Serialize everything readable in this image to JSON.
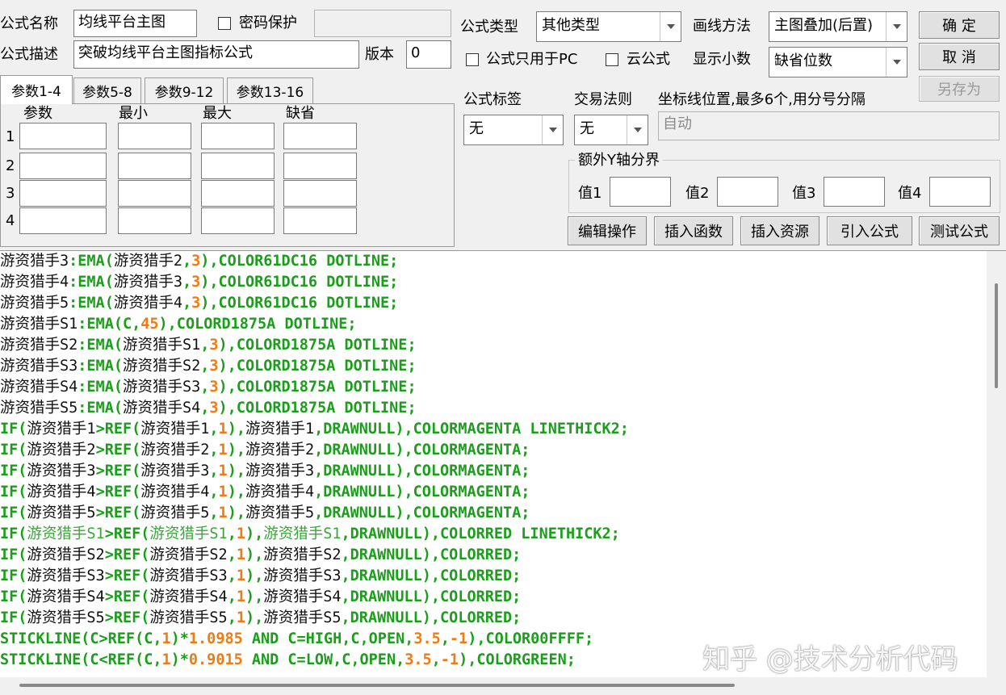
{
  "form": {
    "name_label": "公式名称",
    "name_value": "均线平台主图",
    "password_label": "密码保护",
    "type_label": "公式类型",
    "type_value": "其他类型",
    "draw_label": "画线方法",
    "draw_value": "主图叠加(后置)",
    "desc_label": "公式描述",
    "desc_value": "突破均线平台主图指标公式",
    "version_label": "版本",
    "version_value": "0",
    "pc_only_label": "公式只用于PC",
    "cloud_label": "云公式",
    "decimals_label": "显示小数",
    "decimals_value": "缺省位数"
  },
  "buttons": {
    "ok": "确  定",
    "cancel": "取  消",
    "save_as": "另存为",
    "edit_ops": "编辑操作",
    "insert_func": "插入函数",
    "insert_res": "插入资源",
    "import_formula": "引入公式",
    "test_formula": "测试公式"
  },
  "tabs": [
    "参数1-4",
    "参数5-8",
    "参数9-12",
    "参数13-16"
  ],
  "params": {
    "headers": [
      "参数",
      "最小",
      "最大",
      "缺省"
    ],
    "rows": [
      "1",
      "2",
      "3",
      "4"
    ]
  },
  "right_panel": {
    "tag_label": "公式标签",
    "tag_value": "无",
    "rule_label": "交易法则",
    "rule_value": "无",
    "coord_label": "坐标线位置,最多6个,用分号分隔",
    "coord_placeholder": "自动",
    "yaxis_title": "额外Y轴分界",
    "v1": "值1",
    "v2": "值2",
    "v3": "值3",
    "v4": "值4"
  },
  "code_lines": [
    [
      [
        "black",
        "游资猎手3"
      ],
      [
        "green",
        ":EMA("
      ],
      [
        "black",
        "游资猎手2"
      ],
      [
        "green",
        ","
      ],
      [
        "orange",
        "3"
      ],
      [
        "green",
        "),COLOR61DC16 DOTLINE;"
      ]
    ],
    [
      [
        "black",
        "游资猎手4"
      ],
      [
        "green",
        ":EMA("
      ],
      [
        "black",
        "游资猎手3"
      ],
      [
        "green",
        ","
      ],
      [
        "orange",
        "3"
      ],
      [
        "green",
        "),COLOR61DC16 DOTLINE;"
      ]
    ],
    [
      [
        "black",
        "游资猎手5"
      ],
      [
        "green",
        ":EMA("
      ],
      [
        "black",
        "游资猎手4"
      ],
      [
        "green",
        ","
      ],
      [
        "orange",
        "3"
      ],
      [
        "green",
        "),COLOR61DC16 DOTLINE;"
      ]
    ],
    [
      [
        "black",
        "游资猎手S1"
      ],
      [
        "green",
        ":EMA(C,"
      ],
      [
        "orange",
        "45"
      ],
      [
        "green",
        "),COLORD1875A DOTLINE;"
      ]
    ],
    [
      [
        "black",
        "游资猎手S2"
      ],
      [
        "green",
        ":EMA("
      ],
      [
        "black",
        "游资猎手S1"
      ],
      [
        "green",
        ","
      ],
      [
        "orange",
        "3"
      ],
      [
        "green",
        "),COLORD1875A DOTLINE;"
      ]
    ],
    [
      [
        "black",
        "游资猎手S3"
      ],
      [
        "green",
        ":EMA("
      ],
      [
        "black",
        "游资猎手S2"
      ],
      [
        "green",
        ","
      ],
      [
        "orange",
        "3"
      ],
      [
        "green",
        "),COLORD1875A DOTLINE;"
      ]
    ],
    [
      [
        "black",
        "游资猎手S4"
      ],
      [
        "green",
        ":EMA("
      ],
      [
        "black",
        "游资猎手S3"
      ],
      [
        "green",
        ","
      ],
      [
        "orange",
        "3"
      ],
      [
        "green",
        "),COLORD1875A DOTLINE;"
      ]
    ],
    [
      [
        "black",
        "游资猎手S5"
      ],
      [
        "green",
        ":EMA("
      ],
      [
        "black",
        "游资猎手S4"
      ],
      [
        "green",
        ","
      ],
      [
        "orange",
        "3"
      ],
      [
        "green",
        "),COLORD1875A DOTLINE;"
      ]
    ],
    [
      [
        "green",
        "IF("
      ],
      [
        "black",
        "游资猎手1"
      ],
      [
        "green",
        ">REF("
      ],
      [
        "black",
        "游资猎手1"
      ],
      [
        "green",
        ","
      ],
      [
        "orange",
        "1"
      ],
      [
        "green",
        "),"
      ],
      [
        "black",
        "游资猎手1"
      ],
      [
        "green",
        ",DRAWNULL),COLORMAGENTA LINETHICK2;"
      ]
    ],
    [
      [
        "green",
        "IF("
      ],
      [
        "black",
        "游资猎手2"
      ],
      [
        "green",
        ">REF("
      ],
      [
        "black",
        "游资猎手2"
      ],
      [
        "green",
        ","
      ],
      [
        "orange",
        "1"
      ],
      [
        "green",
        "),"
      ],
      [
        "black",
        "游资猎手2"
      ],
      [
        "green",
        ",DRAWNULL),COLORMAGENTA;"
      ]
    ],
    [
      [
        "green",
        "IF("
      ],
      [
        "black",
        "游资猎手3"
      ],
      [
        "green",
        ">REF("
      ],
      [
        "black",
        "游资猎手3"
      ],
      [
        "green",
        ","
      ],
      [
        "orange",
        "1"
      ],
      [
        "green",
        "),"
      ],
      [
        "black",
        "游资猎手3"
      ],
      [
        "green",
        ",DRAWNULL),COLORMAGENTA;"
      ]
    ],
    [
      [
        "green",
        "IF("
      ],
      [
        "black",
        "游资猎手4"
      ],
      [
        "green",
        ">REF("
      ],
      [
        "black",
        "游资猎手4"
      ],
      [
        "green",
        ","
      ],
      [
        "orange",
        "1"
      ],
      [
        "green",
        "),"
      ],
      [
        "black",
        "游资猎手4"
      ],
      [
        "green",
        ",DRAWNULL),COLORMAGENTA;"
      ]
    ],
    [
      [
        "green",
        "IF("
      ],
      [
        "black",
        "游资猎手5"
      ],
      [
        "green",
        ">REF("
      ],
      [
        "black",
        "游资猎手5"
      ],
      [
        "green",
        ","
      ],
      [
        "orange",
        "1"
      ],
      [
        "green",
        "),"
      ],
      [
        "black",
        "游资猎手5"
      ],
      [
        "green",
        ",DRAWNULL),COLORMAGENTA;"
      ]
    ],
    [
      [
        "green",
        "IF("
      ],
      [
        "lgreen",
        "游资猎手S1"
      ],
      [
        "green",
        ">REF("
      ],
      [
        "lgreen",
        "游资猎手S1"
      ],
      [
        "green",
        ","
      ],
      [
        "orange",
        "1"
      ],
      [
        "green",
        "),"
      ],
      [
        "lgreen",
        "游资猎手S1"
      ],
      [
        "green",
        ",DRAWNULL),COLORRED LINETHICK2;"
      ]
    ],
    [
      [
        "green",
        "IF("
      ],
      [
        "black",
        "游资猎手S2"
      ],
      [
        "green",
        ">REF("
      ],
      [
        "black",
        "游资猎手S2"
      ],
      [
        "green",
        ","
      ],
      [
        "orange",
        "1"
      ],
      [
        "green",
        "),"
      ],
      [
        "black",
        "游资猎手S2"
      ],
      [
        "green",
        ",DRAWNULL),COLORRED;"
      ]
    ],
    [
      [
        "green",
        "IF("
      ],
      [
        "black",
        "游资猎手S3"
      ],
      [
        "green",
        ">REF("
      ],
      [
        "black",
        "游资猎手S3"
      ],
      [
        "green",
        ","
      ],
      [
        "orange",
        "1"
      ],
      [
        "green",
        "),"
      ],
      [
        "black",
        "游资猎手S3"
      ],
      [
        "green",
        ",DRAWNULL),COLORRED;"
      ]
    ],
    [
      [
        "green",
        "IF("
      ],
      [
        "black",
        "游资猎手S4"
      ],
      [
        "green",
        ">REF("
      ],
      [
        "black",
        "游资猎手S4"
      ],
      [
        "green",
        ","
      ],
      [
        "orange",
        "1"
      ],
      [
        "green",
        "),"
      ],
      [
        "black",
        "游资猎手S4"
      ],
      [
        "green",
        ",DRAWNULL),COLORRED;"
      ]
    ],
    [
      [
        "green",
        "IF("
      ],
      [
        "black",
        "游资猎手S5"
      ],
      [
        "green",
        ">REF("
      ],
      [
        "black",
        "游资猎手S5"
      ],
      [
        "green",
        ","
      ],
      [
        "orange",
        "1"
      ],
      [
        "green",
        "),"
      ],
      [
        "black",
        "游资猎手S5"
      ],
      [
        "green",
        ",DRAWNULL),COLORRED;"
      ]
    ],
    [
      [
        "green",
        "STICKLINE(C>REF(C,"
      ],
      [
        "orange",
        "1"
      ],
      [
        "green",
        ")*"
      ],
      [
        "orange",
        "1.0985"
      ],
      [
        "green",
        " AND C=HIGH,C,OPEN,"
      ],
      [
        "orange",
        "3.5"
      ],
      [
        "green",
        ","
      ],
      [
        "orange",
        "-1"
      ],
      [
        "green",
        "),COLOR00FFFF;"
      ]
    ],
    [
      [
        "green",
        "STICKLINE(C<REF(C,"
      ],
      [
        "orange",
        "1"
      ],
      [
        "green",
        ")*"
      ],
      [
        "orange",
        "0.9015"
      ],
      [
        "green",
        " AND C=LOW,C,OPEN,"
      ],
      [
        "orange",
        "3.5"
      ],
      [
        "green",
        ","
      ],
      [
        "orange",
        "-1"
      ],
      [
        "green",
        "),COLORGREEN;"
      ]
    ]
  ],
  "colors": {
    "black": "#111111",
    "green": "#1b9e1b",
    "orange": "#f07b12",
    "lgreen": "#3aa63a"
  },
  "watermark": "知乎 @技术分析代码"
}
